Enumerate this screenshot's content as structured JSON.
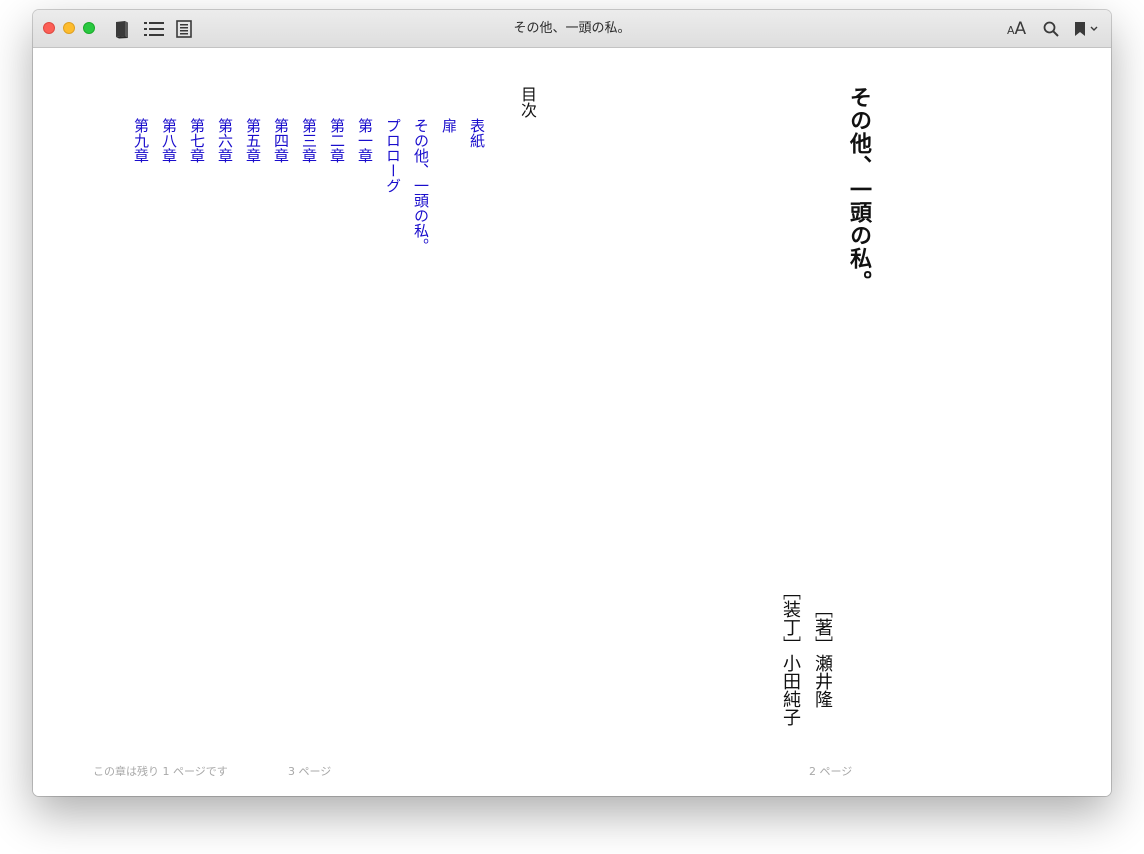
{
  "window": {
    "title": "その他、一頭の私。"
  },
  "toolbar": {
    "library_icon": "book-icon",
    "toc_icon": "list-icon",
    "notes_icon": "notes-icon",
    "font_small": "A",
    "font_large": "A",
    "search_icon": "search-icon",
    "bookmark_icon": "bookmark-icon"
  },
  "title_page": {
    "title": "その他、一頭の私。",
    "author_credit": "［著］瀬井隆",
    "design_credit": "［装丁］小田純子"
  },
  "toc": {
    "heading": "目次",
    "items": [
      {
        "label": "表紙"
      },
      {
        "label": "扉"
      },
      {
        "label": "その他、一頭の私。"
      },
      {
        "label": "プロローグ"
      },
      {
        "label": "第一章"
      },
      {
        "label": "第二章"
      },
      {
        "label": "第三章"
      },
      {
        "label": "第四章"
      },
      {
        "label": "第五章"
      },
      {
        "label": "第六章"
      },
      {
        "label": "第七章"
      },
      {
        "label": "第八章"
      },
      {
        "label": "第九章"
      }
    ]
  },
  "footer": {
    "remaining": "この章は残り 1 ページです",
    "left_page": "3 ページ",
    "right_page": "2 ページ"
  },
  "colors": {
    "link": "#1a0dcc",
    "text": "#111111",
    "footer": "#a8a8a8"
  }
}
